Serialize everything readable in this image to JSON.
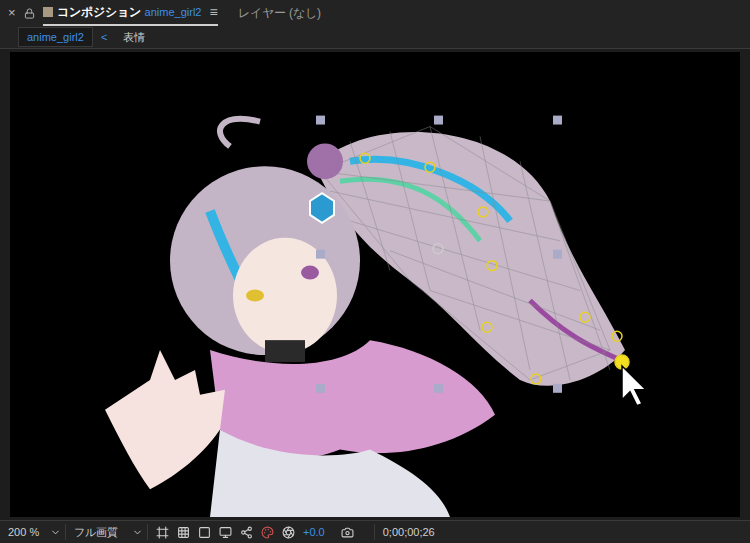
{
  "panel_tabs": [
    {
      "close": "×",
      "label": "コンポジション",
      "comp_name": "anime_girl2",
      "menu": "≡",
      "selected": true
    },
    {
      "label": "レイヤー (なし)",
      "selected": false
    }
  ],
  "breadcrumb": {
    "items": [
      {
        "label": "anime_girl2",
        "selected": true
      },
      {
        "label": "表情",
        "selected": false
      }
    ],
    "separator": "<"
  },
  "viewer": {
    "puppet_pins": [
      {
        "selected": false
      },
      {
        "selected": false
      },
      {
        "selected": false
      },
      {
        "selected": false
      },
      {
        "selected": false
      },
      {
        "selected": false
      },
      {
        "selected": false
      },
      {
        "selected": false
      },
      {
        "selected": true
      }
    ]
  },
  "toolbar": {
    "zoom": "200 %",
    "quality": "フル画質",
    "exposure": "+0.0",
    "timecode": "0;00;00;26"
  }
}
